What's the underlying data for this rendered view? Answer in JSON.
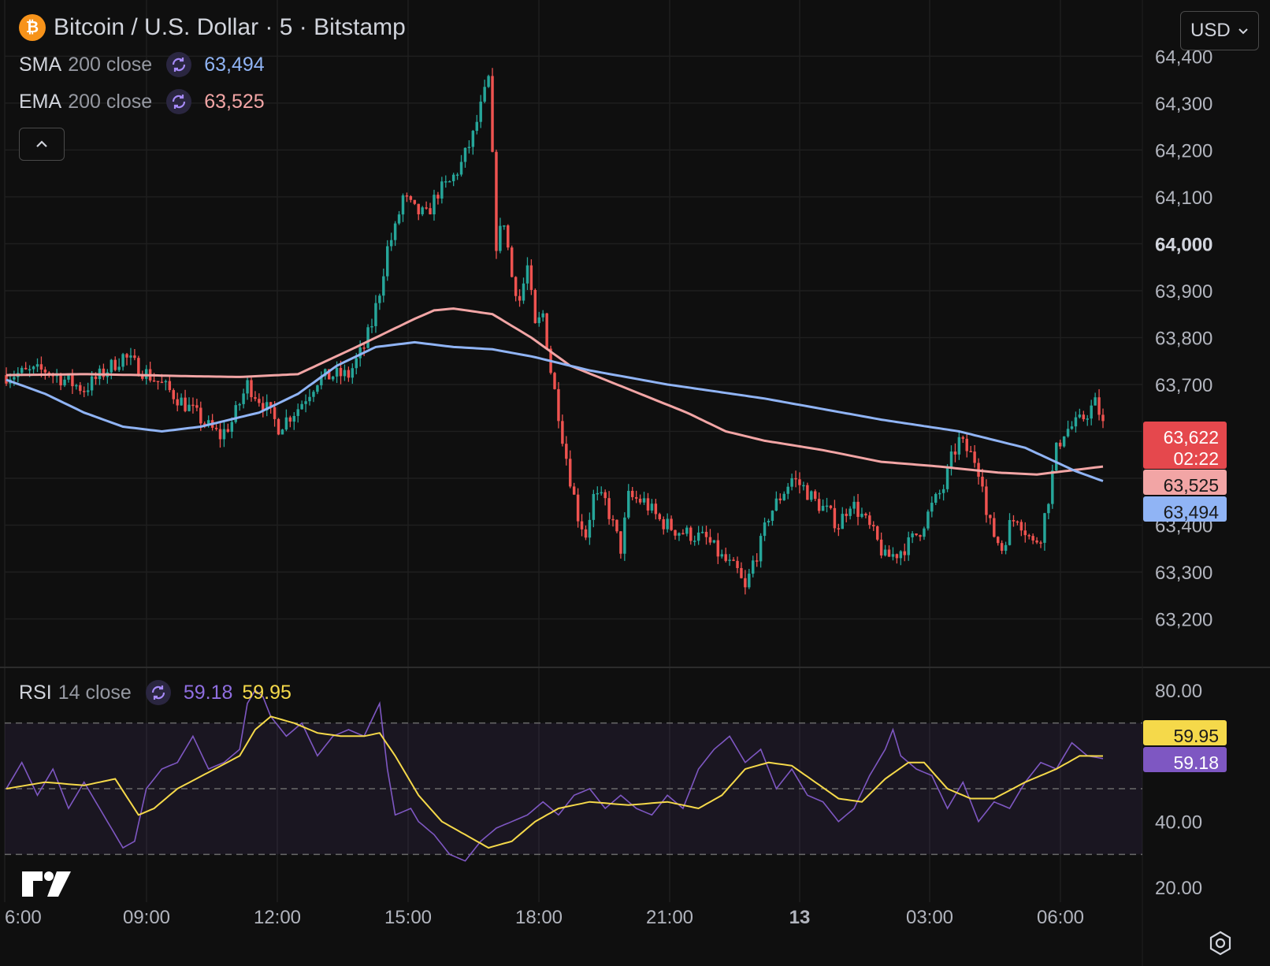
{
  "header": {
    "symbol_icon": "bitcoin-icon",
    "title": "Bitcoin / U.S. Dollar · 5 · Bitstamp",
    "currency": "USD"
  },
  "indicators": [
    {
      "name": "SMA",
      "params": "200 close",
      "value": "63,494",
      "color": "#90b4f5"
    },
    {
      "name": "EMA",
      "params": "200 close",
      "value": "63,525",
      "color": "#f2a5a5"
    }
  ],
  "rsi_legend": {
    "name": "RSI",
    "params": "14 close",
    "value": "59.18",
    "ma_value": "59.95",
    "color": "#7e57c2",
    "ma_color": "#f5d94a"
  },
  "colors": {
    "up": "#26a69a",
    "down": "#ef5350",
    "sma": "#90b4f5",
    "ema": "#f2a5a5",
    "rsi": "#7e57c2",
    "rsi_ma": "#f5d94a",
    "background": "#0f0f0f"
  },
  "price_badges": {
    "last": "63,622",
    "countdown": "02:22",
    "ema": "63,525",
    "sma": "63,494",
    "rsi_ma": "59.95",
    "rsi": "59.18"
  },
  "chart_data": [
    {
      "type": "candlestick",
      "title": "Bitcoin / U.S. Dollar · 5 · Bitstamp",
      "ylim": [
        63100,
        64520
      ],
      "price_ticks": [
        "64,400",
        "64,300",
        "64,200",
        "64,100",
        "64,000",
        "63,900",
        "63,800",
        "63,700",
        "63,400",
        "63,300",
        "63,200"
      ],
      "time_ticks": [
        "6:00",
        "09:00",
        "12:00",
        "15:00",
        "18:00",
        "21:00",
        "13",
        "03:00",
        "06:00"
      ],
      "last_price": 63622,
      "close_path": [
        [
          0,
          63720
        ],
        [
          10,
          63730
        ],
        [
          20,
          63690
        ],
        [
          30,
          63760
        ],
        [
          40,
          63700
        ],
        [
          47,
          63650
        ],
        [
          52,
          63610
        ],
        [
          55,
          63590
        ],
        [
          58,
          63620
        ],
        [
          62,
          63700
        ],
        [
          66,
          63660
        ],
        [
          70,
          63610
        ],
        [
          75,
          63650
        ],
        [
          80,
          63710
        ],
        [
          84,
          63720
        ],
        [
          88,
          63720
        ],
        [
          92,
          63780
        ],
        [
          94,
          63830
        ],
        [
          96,
          63900
        ],
        [
          98,
          63990
        ],
        [
          100,
          64030
        ],
        [
          102,
          64100
        ],
        [
          105,
          64070
        ],
        [
          108,
          64060
        ],
        [
          111,
          64110
        ],
        [
          114,
          64130
        ],
        [
          117,
          64170
        ],
        [
          120,
          64230
        ],
        [
          122,
          64290
        ],
        [
          124,
          64350
        ],
        [
          125,
          64180
        ],
        [
          126,
          64000
        ],
        [
          128,
          64050
        ],
        [
          130,
          63930
        ],
        [
          132,
          63880
        ],
        [
          134,
          63950
        ],
        [
          136,
          63820
        ],
        [
          138,
          63850
        ],
        [
          140,
          63730
        ],
        [
          142,
          63640
        ],
        [
          143,
          63590
        ],
        [
          145,
          63500
        ],
        [
          147,
          63420
        ],
        [
          149,
          63380
        ],
        [
          151,
          63460
        ],
        [
          154,
          63450
        ],
        [
          156,
          63400
        ],
        [
          158,
          63350
        ],
        [
          160,
          63460
        ],
        [
          164,
          63450
        ],
        [
          168,
          63410
        ],
        [
          172,
          63390
        ],
        [
          176,
          63380
        ],
        [
          180,
          63370
        ],
        [
          184,
          63330
        ],
        [
          188,
          63300
        ],
        [
          190,
          63260
        ],
        [
          192,
          63320
        ],
        [
          194,
          63360
        ],
        [
          196,
          63420
        ],
        [
          199,
          63460
        ],
        [
          202,
          63500
        ],
        [
          205,
          63480
        ],
        [
          208,
          63450
        ],
        [
          211,
          63430
        ],
        [
          214,
          63400
        ],
        [
          217,
          63450
        ],
        [
          220,
          63420
        ],
        [
          223,
          63380
        ],
        [
          226,
          63330
        ],
        [
          229,
          63340
        ],
        [
          232,
          63360
        ],
        [
          235,
          63390
        ],
        [
          238,
          63440
        ],
        [
          241,
          63480
        ],
        [
          243,
          63540
        ],
        [
          245,
          63580
        ],
        [
          247,
          63560
        ],
        [
          249,
          63540
        ],
        [
          251,
          63500
        ],
        [
          252,
          63420
        ],
        [
          254,
          63380
        ],
        [
          256,
          63350
        ],
        [
          258,
          63400
        ],
        [
          260,
          63420
        ],
        [
          262,
          63390
        ],
        [
          264,
          63360
        ],
        [
          266,
          63380
        ],
        [
          268,
          63460
        ],
        [
          270,
          63560
        ],
        [
          272,
          63600
        ],
        [
          274,
          63610
        ],
        [
          276,
          63620
        ],
        [
          278,
          63640
        ],
        [
          280,
          63660
        ],
        [
          282,
          63622
        ]
      ],
      "ema_path": [
        [
          0,
          63720
        ],
        [
          20,
          63722
        ],
        [
          35,
          63720
        ],
        [
          45,
          63718
        ],
        [
          60,
          63716
        ],
        [
          75,
          63722
        ],
        [
          90,
          63780
        ],
        [
          105,
          63840
        ],
        [
          110,
          63858
        ],
        [
          115,
          63862
        ],
        [
          125,
          63850
        ],
        [
          135,
          63800
        ],
        [
          145,
          63740
        ],
        [
          160,
          63690
        ],
        [
          175,
          63640
        ],
        [
          185,
          63600
        ],
        [
          195,
          63580
        ],
        [
          210,
          63560
        ],
        [
          225,
          63535
        ],
        [
          240,
          63525
        ],
        [
          255,
          63512
        ],
        [
          265,
          63508
        ],
        [
          275,
          63518
        ],
        [
          282,
          63525
        ]
      ],
      "sma_path": [
        [
          0,
          63710
        ],
        [
          10,
          63680
        ],
        [
          20,
          63640
        ],
        [
          30,
          63610
        ],
        [
          40,
          63600
        ],
        [
          50,
          63610
        ],
        [
          65,
          63640
        ],
        [
          75,
          63680
        ],
        [
          85,
          63740
        ],
        [
          95,
          63780
        ],
        [
          105,
          63790
        ],
        [
          115,
          63780
        ],
        [
          125,
          63775
        ],
        [
          135,
          63760
        ],
        [
          150,
          63730
        ],
        [
          170,
          63700
        ],
        [
          195,
          63670
        ],
        [
          225,
          63625
        ],
        [
          245,
          63600
        ],
        [
          262,
          63565
        ],
        [
          275,
          63515
        ],
        [
          282,
          63494
        ]
      ]
    },
    {
      "type": "line",
      "title": "RSI 14 close",
      "ylim": [
        20,
        80
      ],
      "ticks": [
        "80.00",
        "40.00",
        "20.00"
      ],
      "bands": [
        70,
        50,
        30
      ],
      "series": [
        {
          "name": "RSI",
          "points": [
            [
              0,
              50
            ],
            [
              4,
              58
            ],
            [
              8,
              48
            ],
            [
              12,
              56
            ],
            [
              16,
              44
            ],
            [
              20,
              52
            ],
            [
              24,
              44
            ],
            [
              27,
              38
            ],
            [
              30,
              32
            ],
            [
              33,
              34
            ],
            [
              36,
              50
            ],
            [
              40,
              56
            ],
            [
              44,
              58
            ],
            [
              48,
              66
            ],
            [
              52,
              56
            ],
            [
              56,
              58
            ],
            [
              60,
              62
            ],
            [
              62,
              76
            ],
            [
              64,
              80
            ],
            [
              66,
              78
            ],
            [
              68,
              72
            ],
            [
              72,
              66
            ],
            [
              76,
              70
            ],
            [
              80,
              60
            ],
            [
              84,
              66
            ],
            [
              88,
              68
            ],
            [
              92,
              66
            ],
            [
              96,
              76
            ],
            [
              98,
              56
            ],
            [
              100,
              42
            ],
            [
              104,
              44
            ],
            [
              106,
              40
            ],
            [
              110,
              36
            ],
            [
              114,
              30
            ],
            [
              118,
              28
            ],
            [
              122,
              34
            ],
            [
              126,
              38
            ],
            [
              130,
              40
            ],
            [
              134,
              42
            ],
            [
              138,
              46
            ],
            [
              142,
              42
            ],
            [
              146,
              48
            ],
            [
              150,
              50
            ],
            [
              154,
              44
            ],
            [
              158,
              48
            ],
            [
              162,
              44
            ],
            [
              166,
              42
            ],
            [
              170,
              48
            ],
            [
              174,
              44
            ],
            [
              178,
              56
            ],
            [
              182,
              62
            ],
            [
              186,
              66
            ],
            [
              190,
              58
            ],
            [
              194,
              62
            ],
            [
              198,
              50
            ],
            [
              202,
              56
            ],
            [
              206,
              48
            ],
            [
              210,
              46
            ],
            [
              214,
              40
            ],
            [
              218,
              44
            ],
            [
              222,
              54
            ],
            [
              226,
              62
            ],
            [
              228,
              68
            ],
            [
              230,
              60
            ],
            [
              234,
              56
            ],
            [
              238,
              54
            ],
            [
              242,
              44
            ],
            [
              246,
              52
            ],
            [
              250,
              40
            ],
            [
              254,
              46
            ],
            [
              258,
              44
            ],
            [
              262,
              52
            ],
            [
              266,
              58
            ],
            [
              270,
              56
            ],
            [
              274,
              64
            ],
            [
              278,
              60
            ],
            [
              282,
              59.18
            ]
          ]
        },
        {
          "name": "RSI MA",
          "points": [
            [
              0,
              50
            ],
            [
              10,
              52
            ],
            [
              20,
              51
            ],
            [
              28,
              53
            ],
            [
              34,
              42
            ],
            [
              38,
              44
            ],
            [
              44,
              50
            ],
            [
              52,
              55
            ],
            [
              60,
              60
            ],
            [
              64,
              68
            ],
            [
              68,
              72
            ],
            [
              74,
              70
            ],
            [
              80,
              67
            ],
            [
              86,
              66
            ],
            [
              92,
              66
            ],
            [
              96,
              67
            ],
            [
              100,
              60
            ],
            [
              106,
              48
            ],
            [
              112,
              40
            ],
            [
              118,
              36
            ],
            [
              124,
              32
            ],
            [
              130,
              34
            ],
            [
              136,
              40
            ],
            [
              142,
              44
            ],
            [
              150,
              46
            ],
            [
              160,
              45
            ],
            [
              170,
              46
            ],
            [
              178,
              44
            ],
            [
              184,
              48
            ],
            [
              190,
              56
            ],
            [
              196,
              58
            ],
            [
              202,
              57
            ],
            [
              208,
              52
            ],
            [
              214,
              47
            ],
            [
              220,
              46
            ],
            [
              226,
              53
            ],
            [
              232,
              58
            ],
            [
              236,
              58
            ],
            [
              242,
              50
            ],
            [
              248,
              47
            ],
            [
              254,
              47
            ],
            [
              262,
              52
            ],
            [
              270,
              56
            ],
            [
              276,
              60
            ],
            [
              282,
              59.95
            ]
          ]
        }
      ]
    }
  ]
}
